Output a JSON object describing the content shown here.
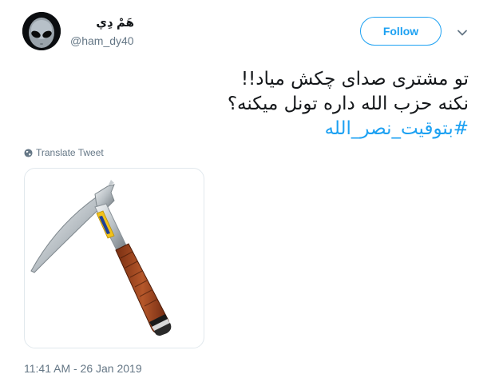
{
  "author": {
    "display_name": "هَمْ دِي",
    "handle": "@ham_dy40",
    "avatar_icon": "alien-avatar"
  },
  "follow_button": {
    "label": "Follow"
  },
  "menu": {
    "icon": "chevron-down-icon"
  },
  "tweet": {
    "line1": "تو مشتری صدای چکش میاد!!",
    "line2": "نکنه حزب الله داره تونل میکنه؟",
    "hashtag": "#بتوقيت_نصر_الله"
  },
  "translate": {
    "label": "Translate Tweet",
    "icon": "globe-icon"
  },
  "media": {
    "description_icon": "rock-hammer-image"
  },
  "timestamp": "11:41 AM - 26 Jan 2019",
  "colors": {
    "accent": "#1da1f2",
    "text": "#14171a",
    "muted": "#657786",
    "border": "#e1e8ed"
  }
}
